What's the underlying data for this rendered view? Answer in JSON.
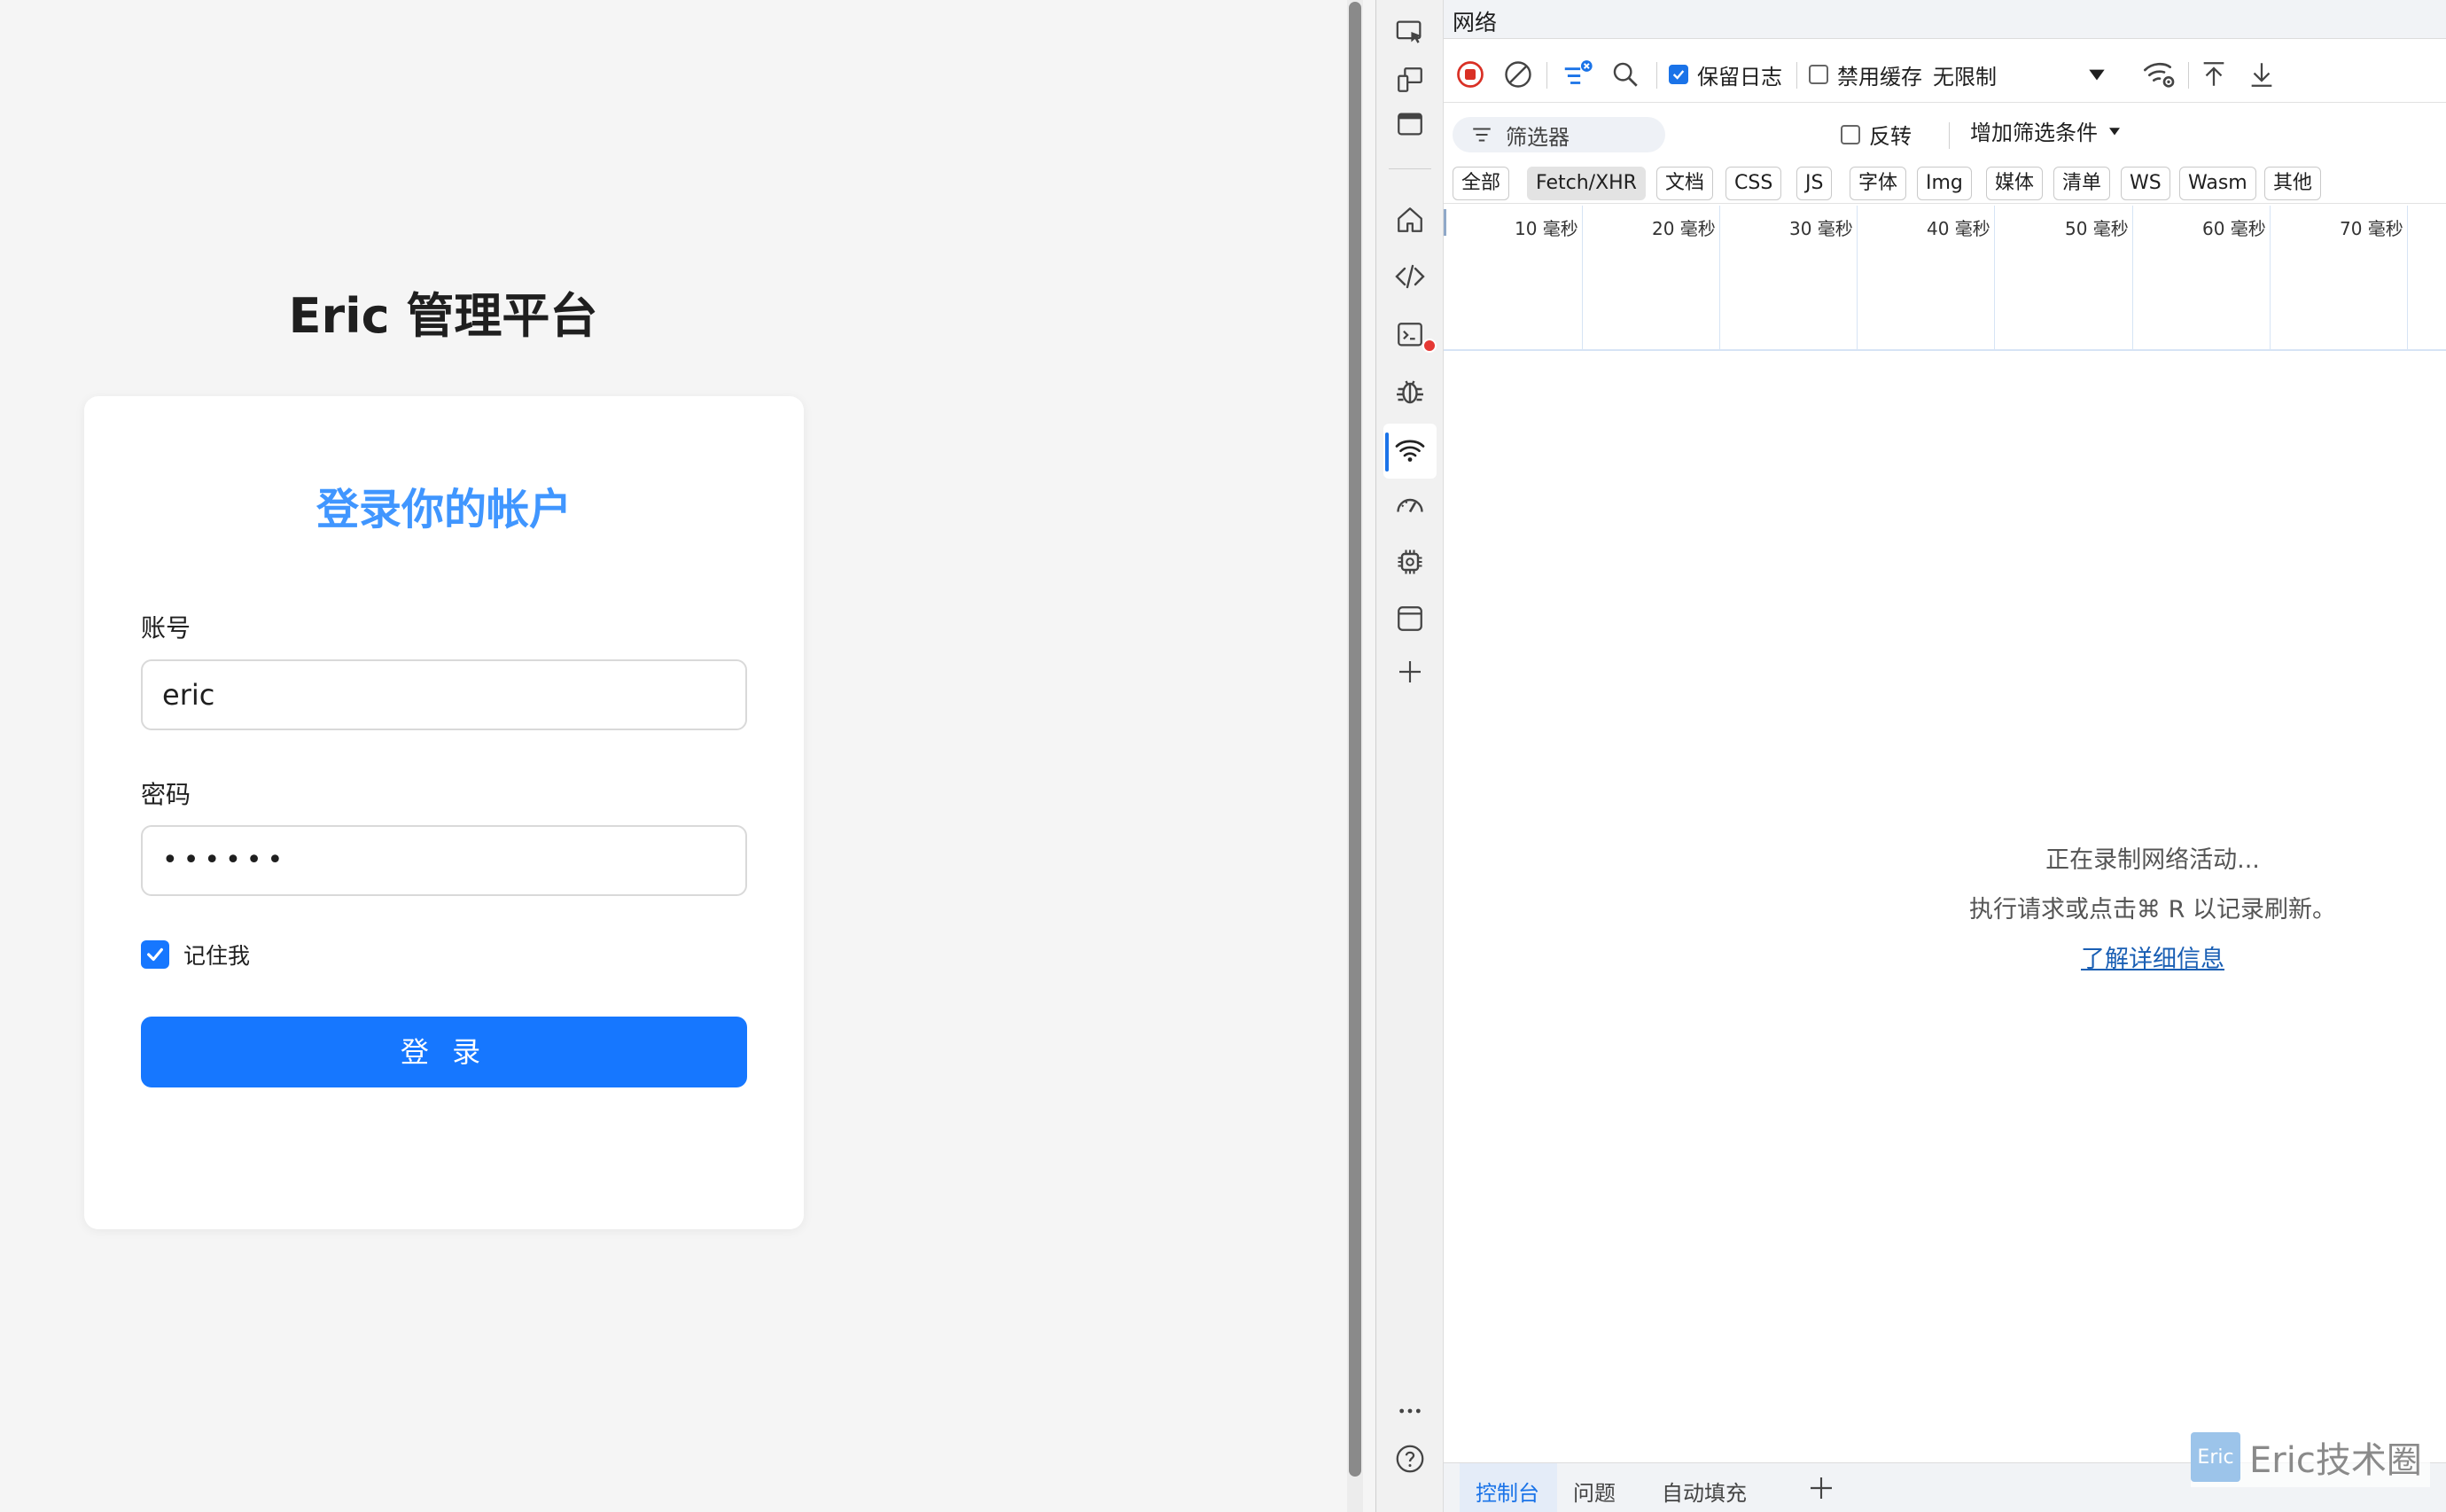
{
  "login_page": {
    "app_title": "Eric 管理平台",
    "card_title": "登录你的帐户",
    "account_label": "账号",
    "account_value": "eric",
    "password_label": "密码",
    "password_value": "••••••",
    "remember_label": "记住我",
    "remember_checked": true,
    "login_button": "登 录",
    "accent_color": "#1677ff",
    "title_color": "#4096ff"
  },
  "devtools": {
    "panel_title": "网络",
    "sidebar_icons": [
      "inspect-icon",
      "device-icon",
      "window-icon",
      "home-icon",
      "code-icon",
      "console-icon",
      "bug-icon",
      "wifi-icon",
      "performance-icon",
      "cpu-icon",
      "application-icon",
      "add-icon",
      "more-icon",
      "help-icon"
    ],
    "toolbar": {
      "preserve_log_label": "保留日志",
      "preserve_log_checked": true,
      "disable_cache_label": "禁用缓存",
      "disable_cache_checked": false,
      "throttling_value": "无限制"
    },
    "filter": {
      "placeholder": "筛选器",
      "invert_label": "反转",
      "more_filters_label": "增加筛选条件"
    },
    "type_filters": [
      "全部",
      "Fetch/XHR",
      "文档",
      "CSS",
      "JS",
      "字体",
      "Img",
      "媒体",
      "清单",
      "WS",
      "Wasm",
      "其他"
    ],
    "selected_type": "Fetch/XHR",
    "timeline_ticks": [
      "10 毫秒",
      "20 毫秒",
      "30 毫秒",
      "40 毫秒",
      "50 毫秒",
      "60 毫秒",
      "70 毫秒"
    ],
    "empty_state": {
      "line1": "正在录制网络活动...",
      "line2": "执行请求或点击⌘ R 以记录刷新。",
      "link": "了解详细信息"
    },
    "drawer_tabs": [
      "控制台",
      "问题",
      "自动填充"
    ],
    "active_drawer_tab": "控制台"
  },
  "watermark": {
    "logo_text": "Eric",
    "text": "Eric技术圈"
  }
}
